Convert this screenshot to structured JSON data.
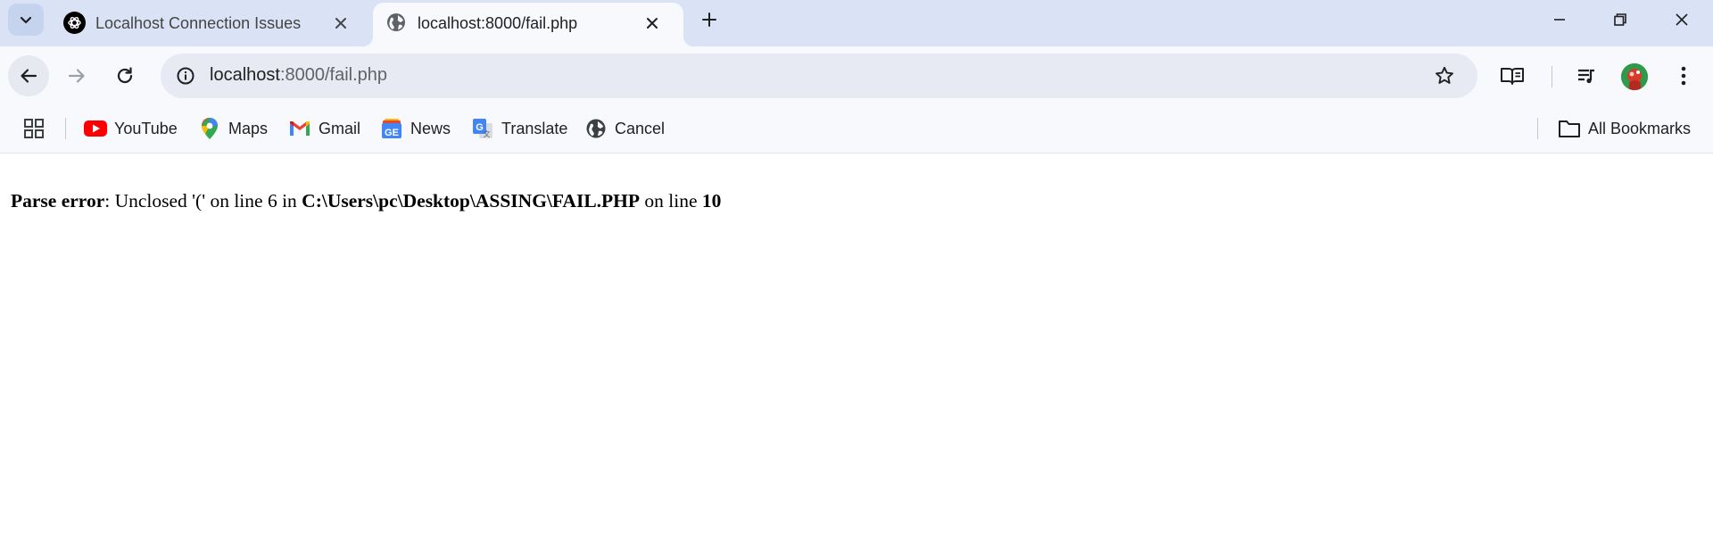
{
  "tabs": [
    {
      "title": "Localhost Connection Issues",
      "favicon": "chatgpt-icon",
      "active": false
    },
    {
      "title": "localhost:8000/fail.php",
      "favicon": "globe-icon",
      "active": true
    }
  ],
  "window_controls": [
    "minimize-icon",
    "restore-icon",
    "close-icon"
  ],
  "address_bar": {
    "url_host": "localhost",
    "url_rest": ":8000/fail.php"
  },
  "bookmarks": [
    {
      "label": "YouTube",
      "icon": "youtube-icon"
    },
    {
      "label": "Maps",
      "icon": "maps-icon"
    },
    {
      "label": "Gmail",
      "icon": "gmail-icon"
    },
    {
      "label": "News",
      "icon": "news-icon"
    },
    {
      "label": "Translate",
      "icon": "translate-icon"
    },
    {
      "label": "Cancel",
      "icon": "globe-icon"
    }
  ],
  "all_bookmarks_label": "All Bookmarks",
  "page": {
    "error_label": "Parse error",
    "error_message": ": Unclosed '(' on line 6 in ",
    "error_file": "C:\\Users\\pc\\Desktop\\ASSING\\FAIL.PHP",
    "on_line_text": " on line ",
    "error_line_number": "10"
  },
  "colors": {
    "tabstrip_bg": "#dae3f5",
    "toolbar_bg": "#f8f9fd",
    "omnibox_bg": "#e7eaf3",
    "youtube_red": "#ff0000",
    "avatar_green": "#2f9b4a"
  }
}
